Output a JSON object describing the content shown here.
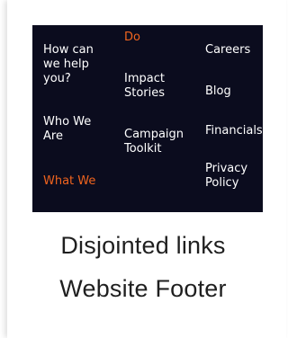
{
  "footer": {
    "links": [
      {
        "id": "how-can-we-help",
        "label": "How can\nwe help\nyou?"
      },
      {
        "id": "who-we-are",
        "label": "Who We\nAre"
      },
      {
        "id": "what-we",
        "label": "What We"
      },
      {
        "id": "do",
        "label": "Do"
      },
      {
        "id": "impact-stories",
        "label": "Impact\nStories"
      },
      {
        "id": "campaign-toolkit",
        "label": "Campaign\nToolkit"
      },
      {
        "id": "careers",
        "label": "Careers"
      },
      {
        "id": "blog",
        "label": "Blog"
      },
      {
        "id": "financials",
        "label": "Financials"
      },
      {
        "id": "privacy-policy",
        "label": "Privacy\nPolicy"
      }
    ],
    "accent_color": "#f0641e",
    "background_color": "#0b0c1e"
  },
  "caption": {
    "line1": "Disjointed links",
    "line2": "Website Footer"
  }
}
